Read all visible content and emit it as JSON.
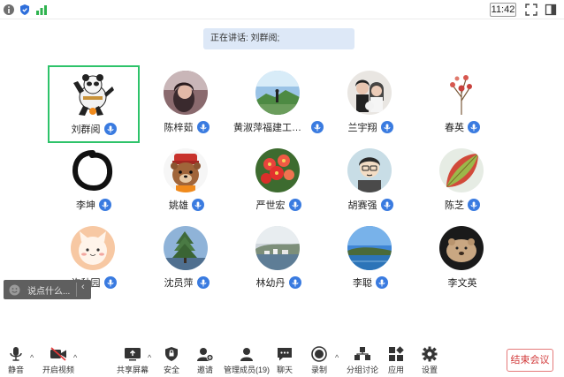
{
  "status": {
    "time": "11:42"
  },
  "speaker": {
    "text": "正在讲话: 刘群阅;"
  },
  "participants": [
    {
      "name": "刘群阅"
    },
    {
      "name": "陈梓茹"
    },
    {
      "name": "黄淑萍福建工程..."
    },
    {
      "name": "兰宇翔"
    },
    {
      "name": "春英"
    },
    {
      "name": "李坤"
    },
    {
      "name": "姚雄"
    },
    {
      "name": "严世宏"
    },
    {
      "name": "胡赛强"
    },
    {
      "name": "陈芝"
    },
    {
      "name": "许秋园"
    },
    {
      "name": "沈员萍"
    },
    {
      "name": "林幼丹"
    },
    {
      "name": "李聪"
    },
    {
      "name": "李文英"
    }
  ],
  "chat": {
    "placeholder": "说点什么...",
    "arrow": "‹"
  },
  "toolbar": {
    "mute": "静音",
    "video": "开启视频",
    "share": "共享屏幕",
    "security": "安全",
    "invite": "邀请",
    "members": "管理成员(19)",
    "chatroom": "聊天",
    "record": "录制",
    "breakout": "分组讨论",
    "apps": "应用",
    "settings": "设置",
    "end": "结束会议"
  },
  "colors": {
    "accent": "#3a7be0",
    "active_border": "#2ec36a",
    "end_red": "#d23b3b"
  }
}
